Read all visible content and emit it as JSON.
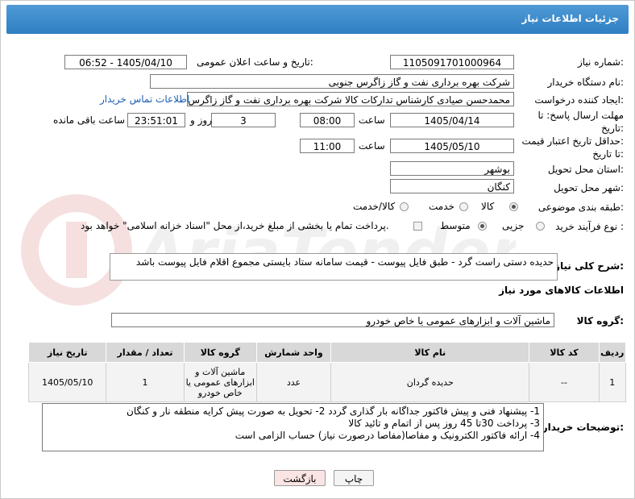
{
  "header": {
    "title": "جزئیات اطلاعات نیاز"
  },
  "fields": {
    "need_number_label": "شماره نیاز:",
    "need_number": "1105091701000964",
    "announce_label": "تاریخ و ساعت اعلان عمومی:",
    "announce_value": "1405/04/10 - 06:52",
    "buyer_org_label": "نام دستگاه خریدار:",
    "buyer_org": "شرکت بهره برداری نفت و گاز زاگرس جنوبی",
    "requester_label": "ایجاد کننده درخواست:",
    "requester": "محمدحسن صیادی کارشناس تدارکات کالا شرکت بهره برداری نفت و گاز زاگرس",
    "contact_link": "اطلاعات تماس خریدار",
    "deadline_label_1": "مهلت ارسال پاسخ: تا",
    "deadline_label_2": "تاریخ:",
    "deadline_date": "1405/04/14",
    "time_word": "ساعت",
    "deadline_time": "08:00",
    "days_value": "3",
    "days_word": "روز و",
    "remaining_time": "23:51:01",
    "remaining_word": "ساعت باقی مانده",
    "min_validity_label_1": "حداقل تاریخ اعتبار قیمت:",
    "min_validity_label_2": "تا تاریخ:",
    "validity_date": "1405/05/10",
    "validity_time": "11:00",
    "province_label": "استان محل تحویل:",
    "province": "بوشهر",
    "city_label": "شهر محل تحویل:",
    "city": "کنگان",
    "category_label": "طبقه بندی موضوعی:",
    "category_goods": "کالا",
    "category_service": "خدمت",
    "category_goods_service": "کالا/خدمت",
    "process_label": "نوع فرآیند خرید :",
    "process_partial": "جزیی",
    "process_medium": "متوسط",
    "payment_note": "پرداخت تمام یا بخشی از مبلغ خرید،از محل \"اسناد خزانه اسلامی\" خواهد بود."
  },
  "summary": {
    "label": "شرح کلی نیاز:",
    "value": "حدیده دستی راست گرد - طبق فایل پیوست - قیمت سامانه ستاد بایستی مجموع اقلام فایل پیوست باشد"
  },
  "goods_section": {
    "title": "اطلاعات کالاهای مورد نیاز",
    "group_label": "گروه کالا:",
    "group_value": "ماشین آلات و ابزارهای عمومی یا خاص خودرو"
  },
  "table": {
    "headers": [
      "ردیف",
      "کد کالا",
      "نام کالا",
      "واحد شمارش",
      "گروه کالا",
      "تعداد / مقدار",
      "تاریخ نیاز"
    ],
    "rows": [
      {
        "row": "1",
        "code": "--",
        "name": "حدیده گردان",
        "unit": "عدد",
        "group": "ماشین آلات و ابزارهای عمومی یا خاص خودرو",
        "qty": "1",
        "date": "1405/05/10"
      }
    ]
  },
  "buyer_notes": {
    "label": "توضیحات خریدار:",
    "lines": [
      "1- پیشنهاد فنی و پیش فاکتور  جداگانه  بار گذاری گردد 2- تحویل به صورت پیش کرایه منطقه نار و کنگان",
      "3- پرداخت 30تا 45 روز پس از اتمام و تائید کالا",
      "4- ارائه فاکتور الکترونیک  و مفاصا(مفاصا درصورت نیاز) حساب  الزامی است"
    ]
  },
  "buttons": {
    "print": "چاپ",
    "back": "بازگشت"
  },
  "watermark": "AriaTender.neT",
  "colors": {
    "header_bg": "#3a88cc",
    "link": "#1a5fb4",
    "back_btn_bg": "#fbe4e4"
  }
}
